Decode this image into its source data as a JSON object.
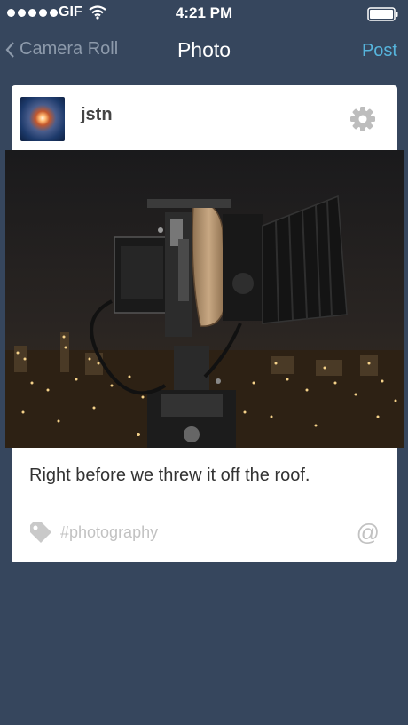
{
  "status_bar": {
    "carrier": "GIF",
    "time": "4:21 PM",
    "signal_icon": "signal-dots-icon",
    "wifi_icon": "wifi-icon",
    "battery_icon": "battery-icon"
  },
  "nav": {
    "back_label": "Camera Roll",
    "title": "Photo",
    "post_label": "Post"
  },
  "post": {
    "username": "jstn",
    "caption": "Right before we threw it off the roof.",
    "tags_placeholder": "#photography",
    "mention_symbol": "@"
  },
  "colors": {
    "background": "#36465d",
    "accent": "#56b4dc",
    "card": "#ffffff"
  }
}
